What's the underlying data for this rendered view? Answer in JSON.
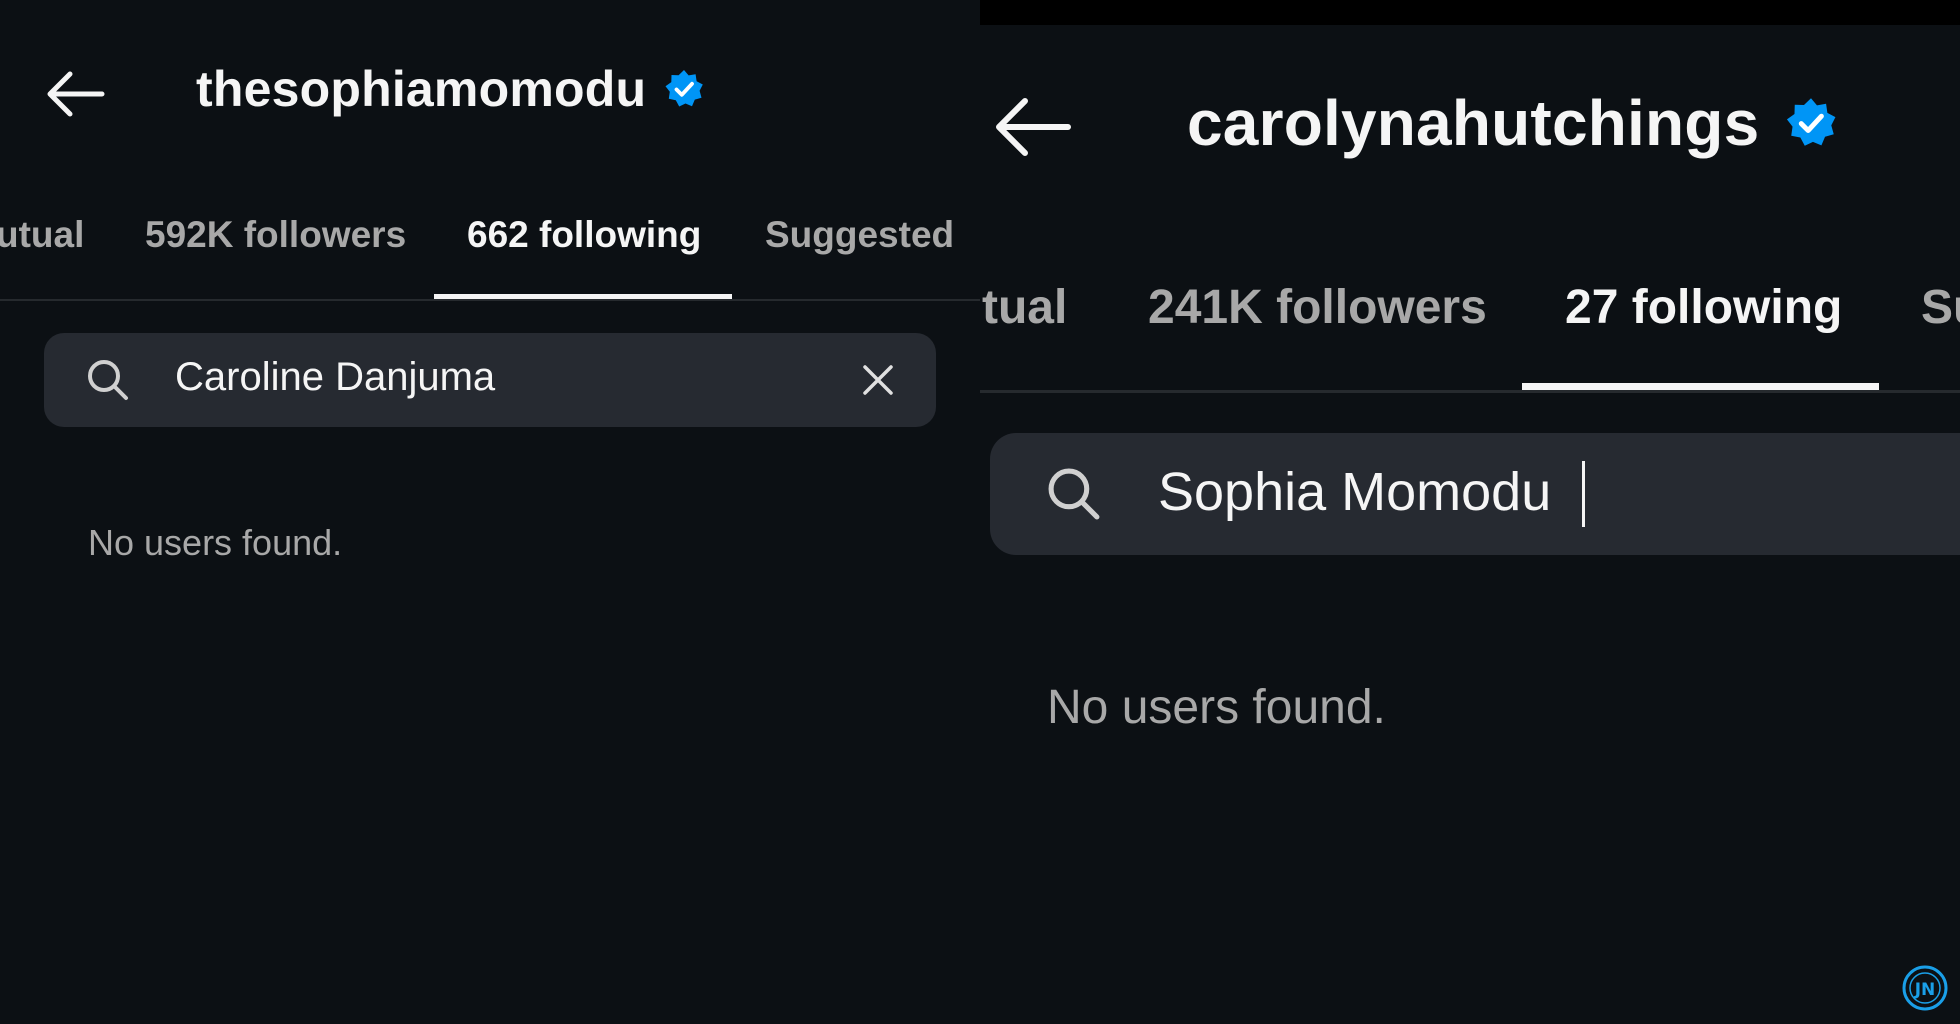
{
  "left": {
    "username": "thesophiamomodu",
    "verified_icon": "verified-badge-icon",
    "tabs": [
      {
        "label": "utual",
        "active": false
      },
      {
        "label": "592K followers",
        "active": false
      },
      {
        "label": "662 following",
        "active": true
      },
      {
        "label": "Suggested",
        "active": false
      }
    ],
    "search": {
      "value": "Caroline Danjuma",
      "icon": "search-icon",
      "clear_icon": "close-icon"
    },
    "empty_message": "No users found."
  },
  "right": {
    "username": "carolynahutchings",
    "verified_icon": "verified-badge-icon",
    "tabs": [
      {
        "label": "tual",
        "active": false
      },
      {
        "label": "241K followers",
        "active": false
      },
      {
        "label": "27 following",
        "active": true
      },
      {
        "label": "Su",
        "active": false
      }
    ],
    "search": {
      "value": "Sophia Momodu",
      "icon": "search-icon"
    },
    "empty_message": "No users found."
  },
  "colors": {
    "background": "#0c1014",
    "verified_blue": "#0095f6",
    "text_primary": "#f5f5f5",
    "text_secondary": "#a8a8a8",
    "search_bg": "#262a31"
  },
  "watermark": {
    "text": "JN",
    "icon": "jn-logo-icon"
  }
}
